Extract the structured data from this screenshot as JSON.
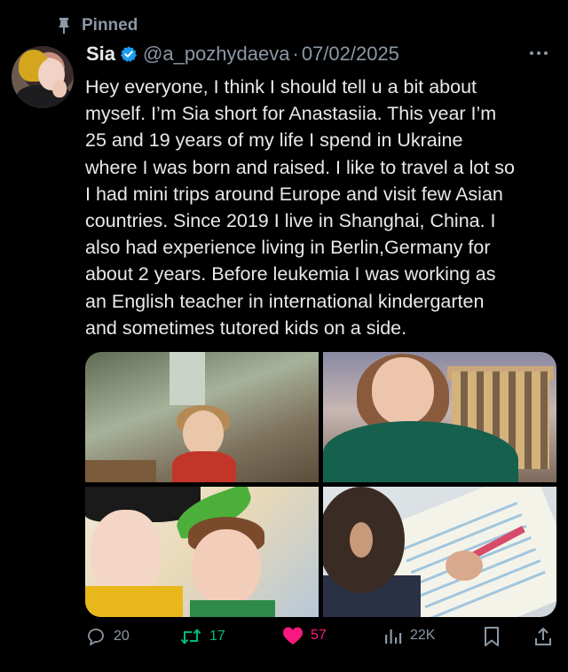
{
  "pinned": {
    "label": "Pinned",
    "icon": "pin-icon"
  },
  "author": {
    "name": "Sia",
    "verified": true,
    "handle": "@a_pozhydaeva",
    "separator": "·",
    "date": "07/02/2025"
  },
  "tweet": {
    "text": "Hey everyone, I think I should tell u a bit about\nmyself. I’m Sia short for Anastasiia. This year I’m\n25 and 19 years of my life I spend in Ukraine\nwhere I was born and raised. I like to travel a lot so\nI had mini trips around Europe and visit few Asian\ncountries. Since 2019 I live in Shanghai, China. I\nalso had experience living in Berlin,Germany for\nabout 2 years. Before leukemia I was working as\nan English teacher in international kindergarten\nand sometimes tutored kids on a side."
  },
  "actions": {
    "reply_count": "20",
    "retweet_count": "17",
    "like_count": "57",
    "view_count": "22K"
  },
  "colors": {
    "background": "#000000",
    "text": "#e7e9ea",
    "muted": "#8b98a5",
    "verified": "#1d9bf0",
    "retweet": "#00ba7c",
    "like": "#f91880"
  }
}
